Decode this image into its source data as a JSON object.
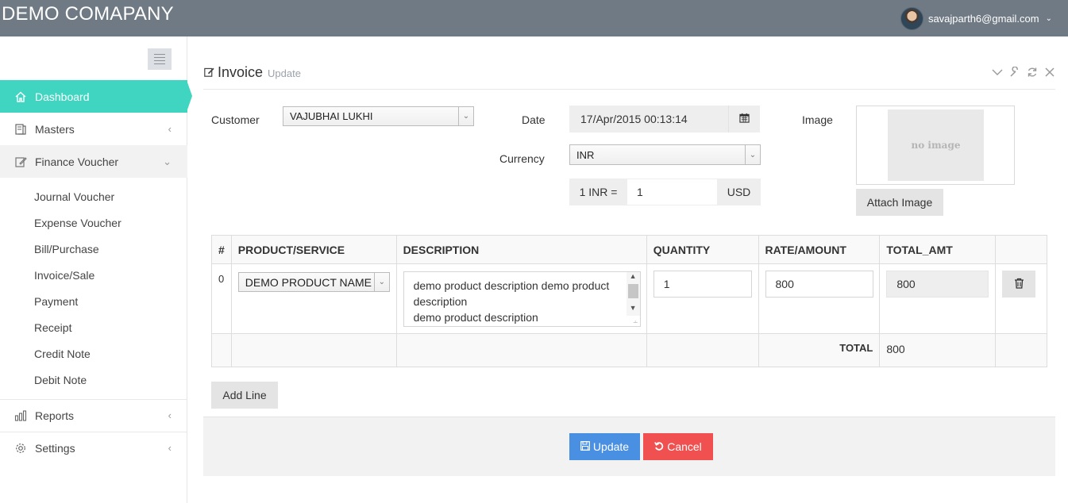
{
  "header": {
    "brand": "DEMO COMAPANY",
    "user_email": "savajparth6@gmail.com"
  },
  "sidebar": {
    "items": [
      {
        "label": "Dashboard",
        "icon": "home-icon"
      },
      {
        "label": "Masters",
        "icon": "book-icon"
      },
      {
        "label": "Finance Voucher",
        "icon": "edit-icon"
      },
      {
        "label": "Reports",
        "icon": "bar-chart-icon"
      },
      {
        "label": "Settings",
        "icon": "gear-icon"
      }
    ],
    "sub_items": [
      "Journal Voucher",
      "Expense Voucher",
      "Bill/Purchase",
      "Invoice/Sale",
      "Payment",
      "Receipt",
      "Credit Note",
      "Debit Note"
    ]
  },
  "panel": {
    "title": "Invoice",
    "subtitle": "Update"
  },
  "form": {
    "customer_label": "Customer",
    "customer_value": "VAJUBHAI LUKHI",
    "date_label": "Date",
    "date_value": "17/Apr/2015 00:13:14",
    "currency_label": "Currency",
    "currency_value": "INR",
    "rate_prefix": "1 INR =",
    "rate_value": "1",
    "rate_suffix": "USD",
    "image_label": "Image",
    "no_image": "no image",
    "attach_label": "Attach Image"
  },
  "table": {
    "headers": [
      "#",
      "PRODUCT/SERVICE",
      "DESCRIPTION",
      "QUANTITY",
      "RATE/AMOUNT",
      "TOTAL_AMT"
    ],
    "row": {
      "index": "0",
      "product": "DEMO PRODUCT NAME",
      "description_line1": "demo product description demo product",
      "description_line2": "description",
      "description_line3": "demo product description",
      "quantity": "1",
      "rate": "800",
      "total": "800"
    },
    "total_label": "TOTAL",
    "total_value": "800"
  },
  "actions": {
    "add_line": "Add Line",
    "update": "Update",
    "cancel": "Cancel"
  },
  "colors": {
    "topbar": "#707a84",
    "accent": "#3fd5c0",
    "update": "#4a90e2",
    "cancel": "#f05050"
  }
}
